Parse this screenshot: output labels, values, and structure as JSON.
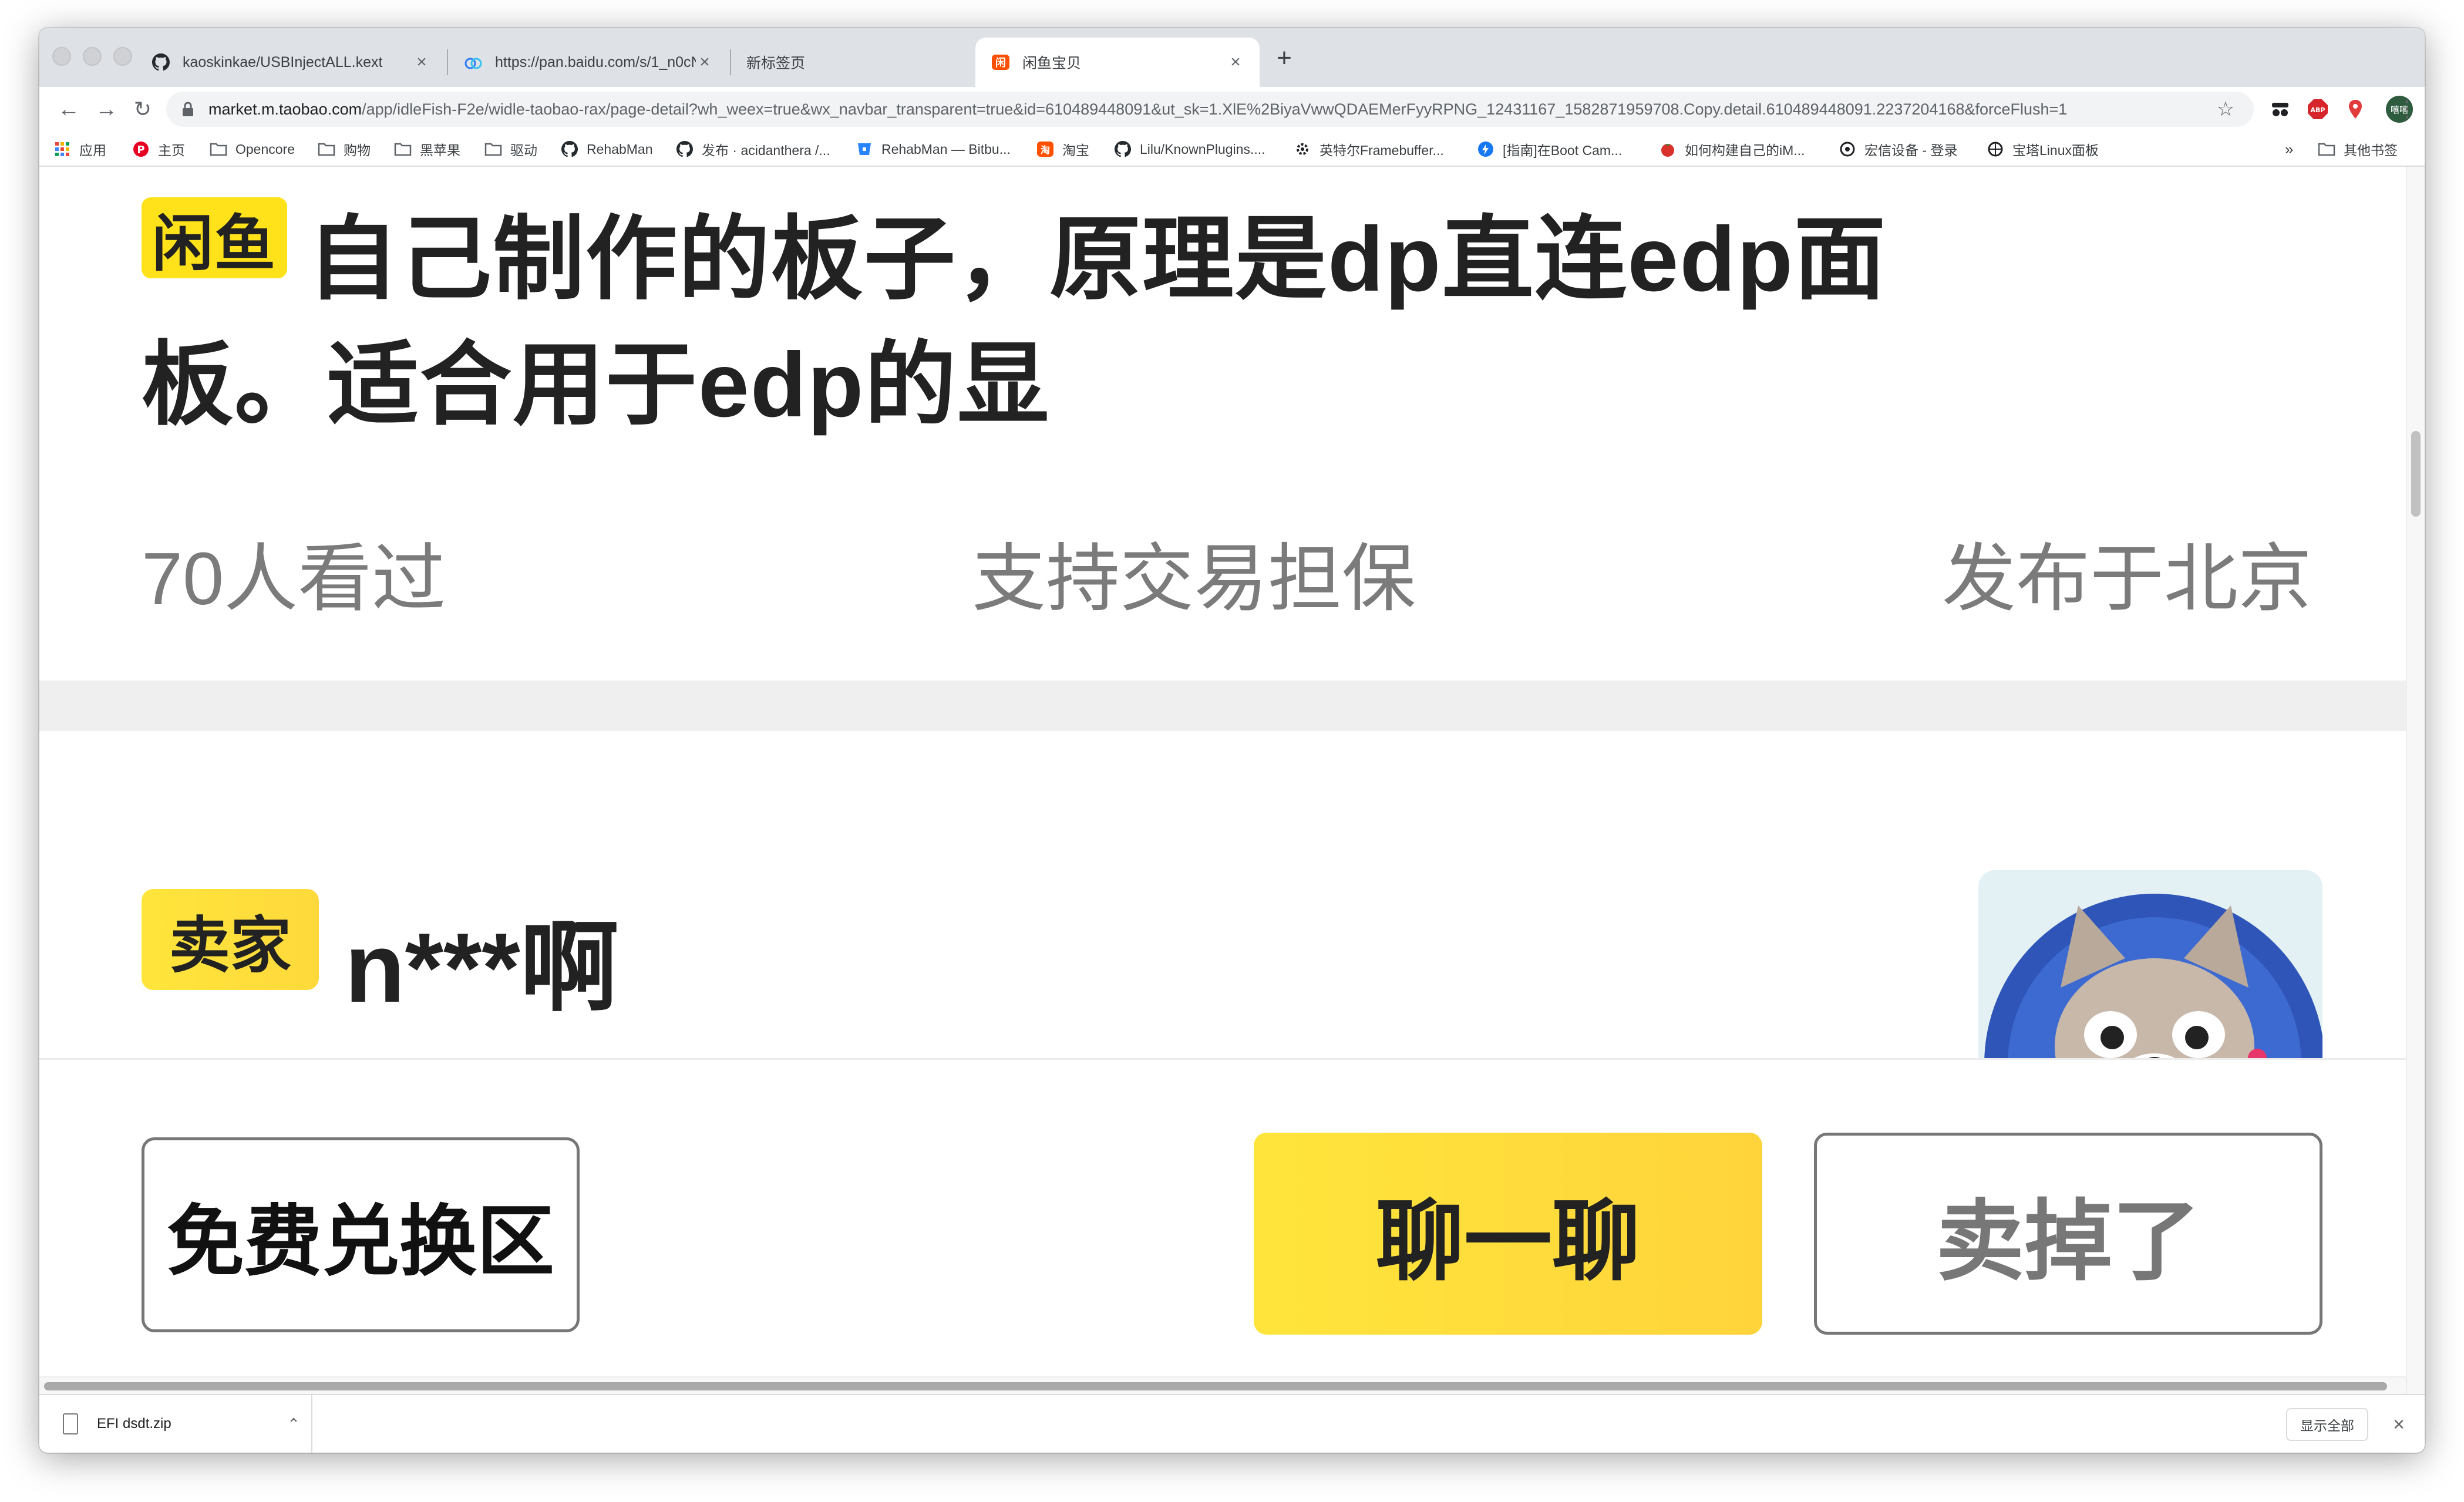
{
  "browser": {
    "tabs": [
      {
        "title": "kaoskinkae/USBInjectALL.kext",
        "icon": "github-icon",
        "active": false
      },
      {
        "title": "https://pan.baidu.com/s/1_n0cN",
        "icon": "baidu-pan-icon",
        "active": false
      },
      {
        "title": "新标签页",
        "icon": "",
        "active": false
      },
      {
        "title": "闲鱼宝贝",
        "icon": "xianyu-icon",
        "active": true
      }
    ],
    "new_tab": "+",
    "tab_close": "×",
    "url_host": "market.m.taobao.com",
    "url_path": "/app/idleFish-F2e/widle-taobao-rax/page-detail?wh_weex=true&wx_navbar_transparent=true&id=610489448091&ut_sk=1.XlE%2BiyaVwwQDAEMerFyyRPNG_12431167_1582871959708.Copy.detail.610489448091.2237204168&forceFlush=1",
    "nav": {
      "back": "←",
      "forward": "→",
      "reload": "↻",
      "star": "☆",
      "menu": "⋮"
    },
    "extensions": {
      "abp": "ABP",
      "profile": "嘻嘻"
    },
    "bookmarks": [
      {
        "label": "应用",
        "icon": "apps-grid-icon"
      },
      {
        "label": "主页",
        "icon": "pinterest-icon"
      },
      {
        "label": "Opencore",
        "icon": "folder-icon"
      },
      {
        "label": "购物",
        "icon": "folder-icon"
      },
      {
        "label": "黑苹果",
        "icon": "folder-icon"
      },
      {
        "label": "驱动",
        "icon": "folder-icon"
      },
      {
        "label": "RehabMan",
        "icon": "github-icon"
      },
      {
        "label": "发布 · acidanthera /...",
        "icon": "github-icon"
      },
      {
        "label": "RehabMan — Bitbu...",
        "icon": "bitbucket-icon"
      },
      {
        "label": "淘宝",
        "icon": "taobao-icon"
      },
      {
        "label": "Lilu/KnownPlugins....",
        "icon": "github-icon"
      },
      {
        "label": "英特尔Framebuffer...",
        "icon": "gear-icon"
      },
      {
        "label": "[指南]在Boot Cam...",
        "icon": "bolt-icon"
      },
      {
        "label": "如何构建自己的iM...",
        "icon": "tomato-icon"
      },
      {
        "label": "宏信设备 - 登录",
        "icon": "globe-icon"
      },
      {
        "label": "宝塔Linux面板",
        "icon": "globe-icon"
      }
    ],
    "bookmarks_overflow": "»",
    "other_bookmarks": "其他书签"
  },
  "page": {
    "brand_badge": "闲鱼",
    "title_line1": "自己制作的板子，原理是dp直连edp面",
    "title_line2": "板。适合用于edp的显",
    "views": "70人看过",
    "guarantee": "支持交易担保",
    "location": "发布于北京",
    "seller_badge": "卖家",
    "seller_name": "n***啊",
    "buttons": {
      "exchange": "免费兑换区",
      "chat": "聊一聊",
      "sold": "卖掉了"
    }
  },
  "downloads": {
    "file_name": "EFI dsdt.zip",
    "chevron": "⌃",
    "show_all": "显示全部",
    "close": "×"
  },
  "colors": {
    "accent_yellow": "#ffe21a",
    "tabstrip": "#dee1e6",
    "meta_gray": "#7b7b7b"
  }
}
